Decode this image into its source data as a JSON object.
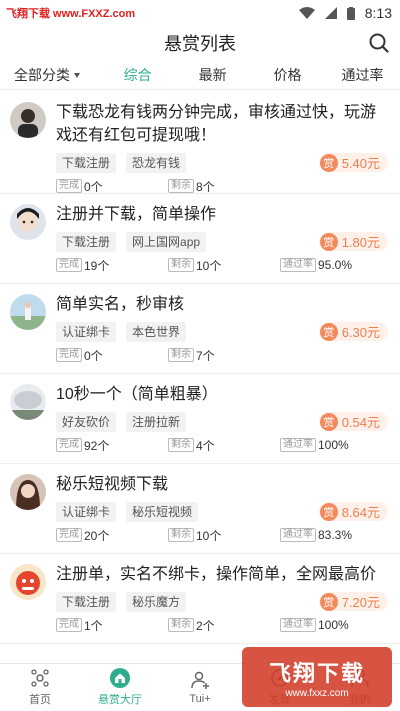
{
  "status_bar": {
    "watermark": "飞翔下载 www.FXXZ.com",
    "time": "8:13"
  },
  "header": {
    "title": "悬赏列表"
  },
  "tabs": [
    {
      "label": "全部分类"
    },
    {
      "label": "综合"
    },
    {
      "label": "最新"
    },
    {
      "label": "价格"
    },
    {
      "label": "通过率"
    }
  ],
  "labels": {
    "done": "完成",
    "remain": "剩余",
    "rate": "通过率",
    "reward_badge": "赏"
  },
  "colors": {
    "accent": "#2fae8f",
    "reward": "#f07d4e",
    "reward_bg": "#fff1ea"
  },
  "tasks": [
    {
      "title": "下载恐龙有钱两分钟完成，审核通过快，玩游戏还有红包可提现哦！",
      "tags": [
        "下载注册",
        "恐龙有钱"
      ],
      "reward": "5.40元",
      "done": "0个",
      "remain": "8个",
      "rate": ""
    },
    {
      "title": "注册并下载，简单操作",
      "tags": [
        "下载注册",
        "网上国网app"
      ],
      "reward": "1.80元",
      "done": "19个",
      "remain": "10个",
      "rate": "95.0%"
    },
    {
      "title": "简单实名，秒审核",
      "tags": [
        "认证绑卡",
        "本色世界"
      ],
      "reward": "6.30元",
      "done": "0个",
      "remain": "7个",
      "rate": ""
    },
    {
      "title": "10秒一个（简单粗暴）",
      "tags": [
        "好友砍价",
        "注册拉新"
      ],
      "reward": "0.54元",
      "done": "92个",
      "remain": "4个",
      "rate": "100%"
    },
    {
      "title": "秘乐短视频下载",
      "tags": [
        "认证绑卡",
        "秘乐短视频"
      ],
      "reward": "8.64元",
      "done": "20个",
      "remain": "10个",
      "rate": "83.3%"
    },
    {
      "title": "注册单，实名不绑卡，操作简单，全网最高价",
      "tags": [
        "下载注册",
        "秘乐魔方"
      ],
      "reward": "7.20元",
      "done": "1个",
      "remain": "2个",
      "rate": "100%"
    }
  ],
  "bottom_nav": [
    {
      "label": "首页",
      "icon": "home-icon"
    },
    {
      "label": "悬赏大厅",
      "icon": "hall-icon"
    },
    {
      "label": "Tui+",
      "icon": "add-user-icon"
    },
    {
      "label": "发现",
      "icon": "discover-icon"
    },
    {
      "label": "我的",
      "icon": "profile-icon"
    }
  ],
  "corner_watermark": {
    "big": "飞翔下载",
    "small": "www.fxxz.com"
  }
}
